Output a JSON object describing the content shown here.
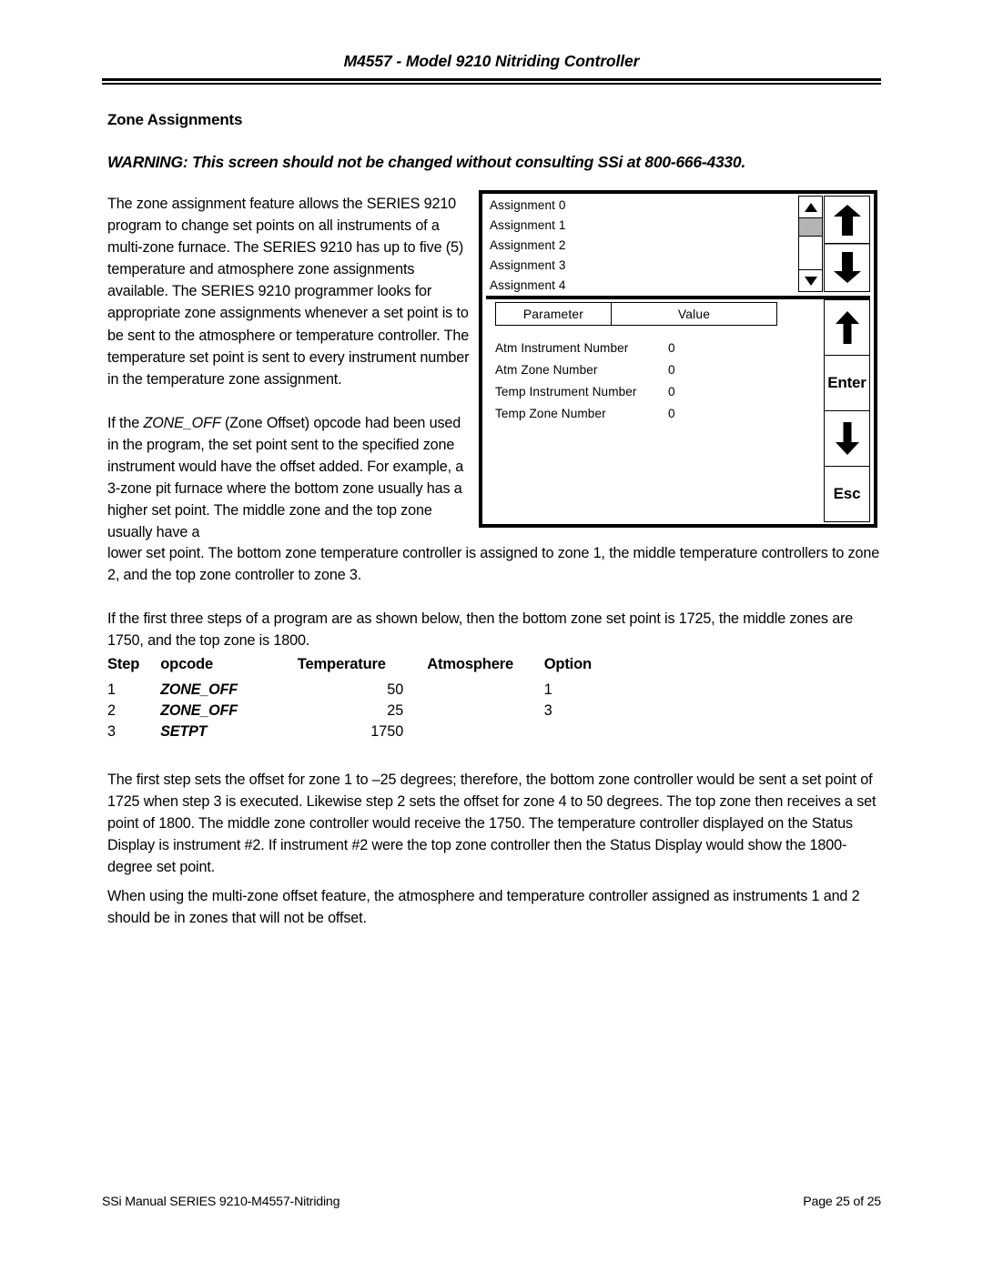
{
  "header": {
    "title": "M4557 - Model 9210 Nitriding Controller"
  },
  "section": {
    "heading": "Zone Assignments",
    "warning": "WARNING: This screen should not be changed without consulting SSi at 800-666-4330."
  },
  "body": {
    "para_left_1": "The zone assignment feature allows the SERIES 9210 program to change set points on all instruments of a multi-zone furnace.  The SERIES 9210 has up to five (5) temperature and atmosphere zone assignments available.   The SERIES 9210 programmer looks for appropriate zone assignments whenever a set point is to be sent to the atmosphere or temperature controller.  The temperature set point is sent to every instrument number in the temperature zone assignment.",
    "para_left_2_pre": " If the ",
    "para_left_2_italic": "ZONE_OFF",
    "para_left_2_post": " (Zone Offset) opcode had been used in the program, the set point sent to the specified zone instrument would have the offset added.  For example, a 3-zone pit furnace where the bottom zone usually has a higher set point.  The middle zone and the top zone usually have a",
    "para_wide_1": "lower set point.  The bottom zone temperature controller is assigned to zone 1, the middle temperature controllers to zone 2, and the top zone controller to zone 3.",
    "para_wide_2": "If the first three steps of a program are as shown below, then the bottom zone set point is 1725, the middle zones are 1750, and the top zone is 1800.",
    "para_after_table": "The first step sets the offset for zone 1 to –25 degrees; therefore, the bottom zone controller would be sent a set point of 1725 when step 3 is executed.  Likewise step 2 sets the offset for zone 4 to 50 degrees.  The top zone then receives a set point of 1800.  The middle zone controller would receive the 1750. The temperature controller displayed on the Status Display is instrument #2.   If instrument #2 were the top zone controller then the Status Display would show the 1800-degree set point.",
    "para_final": "When using the multi-zone offset feature, the atmosphere and temperature controller assigned as instruments 1 and 2 should be in zones that will not be offset."
  },
  "step_table": {
    "columns": [
      "Step",
      "opcode",
      "Temperature",
      "Atmosphere",
      "Option"
    ],
    "rows": [
      {
        "step": "1",
        "opcode": "ZONE_OFF",
        "temperature": "50",
        "atmosphere": "",
        "option": "1"
      },
      {
        "step": "2",
        "opcode": "ZONE_OFF",
        "temperature": "25",
        "atmosphere": "",
        "option": "3"
      },
      {
        "step": "3",
        "opcode": "SETPT",
        "temperature": "1750",
        "atmosphere": "",
        "option": ""
      }
    ]
  },
  "device_screen": {
    "assignments": [
      "Assignment 0",
      "Assignment 1",
      "Assignment 2",
      "Assignment 3",
      "Assignment 4"
    ],
    "table_headers": {
      "parameter": "Parameter",
      "value": "Value"
    },
    "parameters": [
      {
        "name": "Atm Instrument Number",
        "value": "0"
      },
      {
        "name": "Atm Zone Number",
        "value": "0"
      },
      {
        "name": "Temp Instrument Number",
        "value": "0"
      },
      {
        "name": "Temp Zone Number",
        "value": "0"
      }
    ],
    "keys": {
      "enter": "Enter",
      "esc": "Esc"
    },
    "colors": {
      "scroll_thumb": "#b4b4b4",
      "border": "#000000",
      "background": "#ffffff"
    }
  },
  "footer": {
    "left": "SSi Manual SERIES 9210-M4557-Nitriding",
    "right": "Page 25 of 25"
  }
}
